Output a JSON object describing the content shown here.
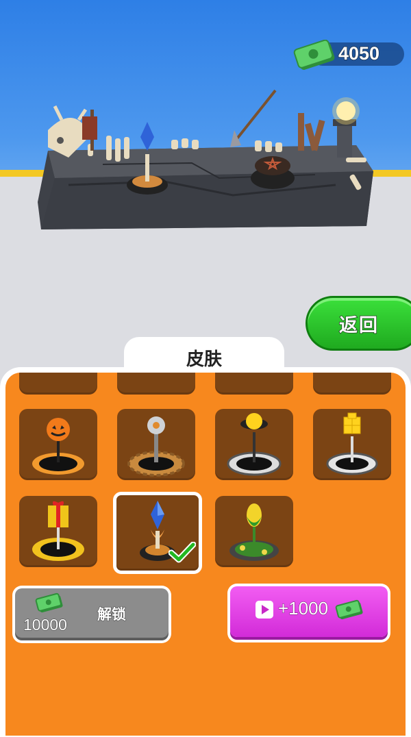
{
  "currency": {
    "amount": "4050",
    "icon": "cash-icon"
  },
  "back_button": {
    "label": "返回"
  },
  "panel": {
    "tab_title": "皮肤"
  },
  "skins": [
    {
      "name": "pumpkin-pedestal",
      "state": "available"
    },
    {
      "name": "gear-orb-pedestal",
      "state": "available"
    },
    {
      "name": "yellow-orb-pedestal",
      "state": "available"
    },
    {
      "name": "yellow-cube-pedestal",
      "state": "available"
    },
    {
      "name": "gift-pedestal",
      "state": "available"
    },
    {
      "name": "blue-crystal-pedestal",
      "state": "selected"
    },
    {
      "name": "flower-bud-pedestal",
      "state": "available"
    }
  ],
  "unlock_button": {
    "price": "10000",
    "label": "解锁"
  },
  "ad_button": {
    "amount": "+1000",
    "icon": "play-icon"
  },
  "colors": {
    "panel": "#f7881e",
    "slot": "#7b4414",
    "back": "#22b822",
    "ad": "#e23fe6"
  }
}
